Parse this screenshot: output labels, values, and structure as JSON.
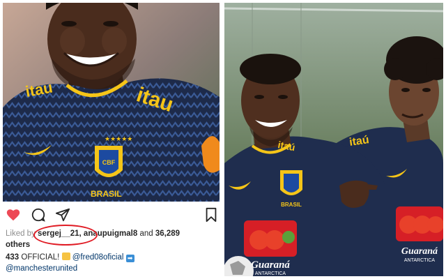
{
  "post": {
    "liked_prefix": "Liked by",
    "liker_1": "sergej__21,",
    "liker_2": "anaupuigmal8",
    "and_word": "and",
    "likes_count": "36,289",
    "others_word": "others",
    "caption_user": "433",
    "caption_text": "OFFICIAL!",
    "mention_1": "@fred08oficial",
    "mention_2": "@manchesterunited"
  },
  "photo_left": {
    "shirt_text": "itau",
    "crest_text": "CBF",
    "brand_text": "BRASIL"
  },
  "photo_right": {
    "crest_text_1": "BRASIL",
    "sponsor_1": "Guaraná",
    "sponsor_1_sub": "ANTARCTICA",
    "sponsor_2": "Guaraná",
    "sponsor_2_sub": "ANTARCTICA",
    "sleeve_text": "itaú"
  },
  "colors": {
    "like_red": "#ed4956",
    "highlight_red": "#e01b24",
    "jersey_navy": "#1f2d4e",
    "jersey_yellow": "#f5c518",
    "link_blue": "#003569"
  },
  "icons": [
    "heart-icon",
    "comment-icon",
    "share-icon",
    "bookmark-icon",
    "pencil-emoji-icon",
    "arrow-right-emoji-icon"
  ]
}
